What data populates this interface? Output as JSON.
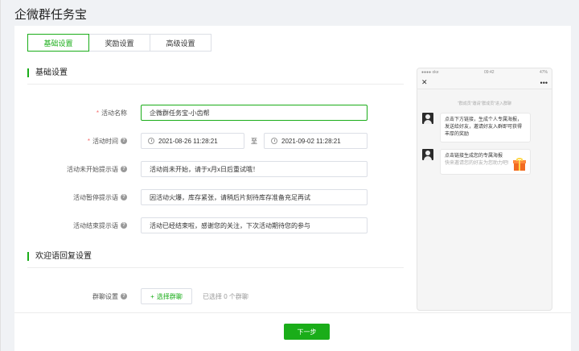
{
  "app": {
    "title": "企微群任务宝"
  },
  "tabs": [
    {
      "label": "基础设置",
      "active": true
    },
    {
      "label": "奖励设置",
      "active": false
    },
    {
      "label": "高级设置",
      "active": false
    }
  ],
  "sections": {
    "basic": "基础设置",
    "welcome": "欢迎语回复设置"
  },
  "form": {
    "activity_name": {
      "label": "活动名称",
      "required": "*",
      "value": "企微群任务宝-小齿帮"
    },
    "activity_time": {
      "label": "活动时间",
      "required": "*",
      "help": "?",
      "start": "2021-08-26 11:28:21",
      "sep": "至",
      "end": "2021-09-02 11:28:21"
    },
    "not_started_tip": {
      "label": "活动未开始提示语",
      "help": "?",
      "value": "活动尚未开始，请于x月x日后重试哦！"
    },
    "paused_tip": {
      "label": "活动暂停提示语",
      "help": "?",
      "value": "因活动火爆，库存紧张，请稍后片刻待库存准备充足再试"
    },
    "ended_tip": {
      "label": "活动结束提示语",
      "help": "?",
      "value": "活动已经结束啦，感谢您的关注，下次活动期待您的参与"
    },
    "group_chat": {
      "label": "群聊设置",
      "help": "?",
      "select_button": "选择群聊",
      "plus": "+",
      "selected_text": "已选择 0 个群聊"
    }
  },
  "footer": {
    "next_button": "下一步"
  },
  "preview": {
    "status": {
      "carrier": "●●●● oke",
      "wifi": "ᯤ",
      "time": "09:42",
      "battery": "47%"
    },
    "nav": {
      "close": "✕",
      "more": "•••"
    },
    "system_message": "\"群成员\"邀请\"群成员\"进入群聊",
    "messages": [
      {
        "lines": [
          "点击下方链接，生成个人专属海报，",
          "发送给好友，邀请好友入群即可获得丰厚的奖励"
        ]
      },
      {
        "title": "点击链接生成您的专属海报",
        "subtitle": "快来邀请您的好友为您助力吧!"
      }
    ]
  },
  "colors": {
    "accent": "#1aad19",
    "required": "#f56c6c"
  },
  "icons": [
    "clock-icon",
    "help-icon",
    "plus-icon",
    "close-icon",
    "more-icon",
    "gift-icon",
    "avatar"
  ]
}
